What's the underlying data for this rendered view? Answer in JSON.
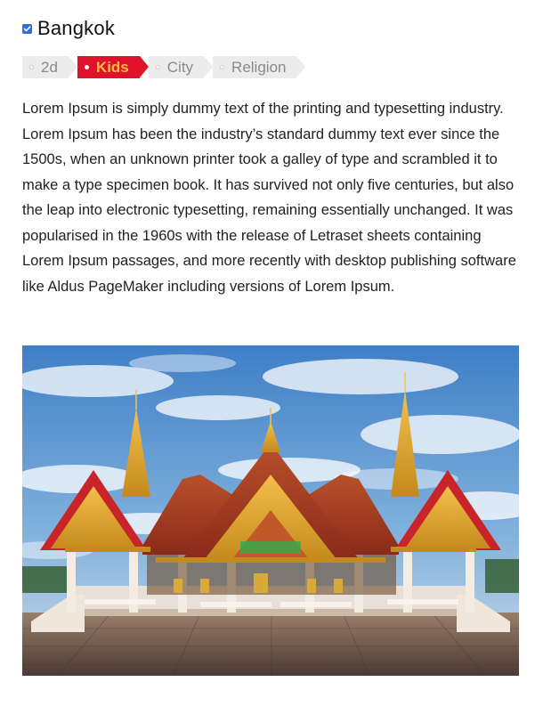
{
  "post": {
    "checked": true,
    "title": "Bangkok",
    "tags": [
      {
        "label": "2d",
        "active": false
      },
      {
        "label": "Kids",
        "active": true
      },
      {
        "label": "City",
        "active": false
      },
      {
        "label": "Religion",
        "active": false
      }
    ],
    "description": "Lorem Ipsum is simply dummy text of the printing and typesetting industry. Lorem Ipsum has been the industry’s standard dummy text ever since the 1500s, when an unknown printer took a galley of type and scrambled it to make a type specimen book. It has survived not only five centuries, but also the leap into electronic typesetting, remaining essentially unchanged. It was popularised in the 1960s with the release of Letraset sheets containing Lorem Ipsum passages, and more recently with desktop publishing software like Aldus PageMaker including versions of Lorem Ipsum."
  },
  "icons": {
    "checkbox": "checkmark-icon",
    "tag_dot": "dot-icon"
  },
  "colors": {
    "accent": "#e0112b",
    "active_tag_text": "#ffc13a",
    "tag_bg": "#ececec",
    "checkbox": "#2f6fe0"
  }
}
